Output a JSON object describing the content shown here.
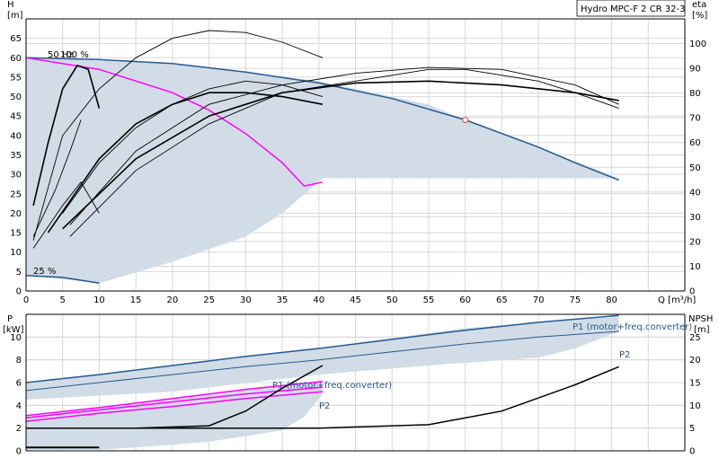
{
  "chart_data": [
    {
      "type": "line",
      "panel": "performance",
      "legend_box": "Hydro MPC-F 2 CR 32-3",
      "ylabel": "H",
      "yunit": "[m]",
      "y2label": "eta",
      "y2unit": "[%]",
      "xlabel": "Q [m³/h]",
      "xlim": [
        0,
        90
      ],
      "ylim": [
        0,
        70
      ],
      "y2lim": [
        0,
        110
      ],
      "xticks": [
        "0",
        "5",
        "10",
        "15",
        "20",
        "25",
        "30",
        "35",
        "40",
        "45",
        "50",
        "55",
        "60",
        "65",
        "70",
        "75",
        "80"
      ],
      "yticks": [
        "0",
        "5",
        "10",
        "15",
        "20",
        "25",
        "30",
        "35",
        "40",
        "45",
        "50",
        "55",
        "60",
        "65"
      ],
      "y2ticks": [
        "0",
        "10",
        "20",
        "30",
        "40",
        "50",
        "60",
        "70",
        "80",
        "90",
        "100"
      ],
      "grid": true,
      "annotations": [
        {
          "text": "50 Hz",
          "x": 3,
          "y": 61
        },
        {
          "text": "100 %",
          "x": 5.5,
          "y": 61
        },
        {
          "text": "25 %",
          "x": 1,
          "y": 5
        }
      ],
      "operating_point": {
        "x": 60,
        "y": 44,
        "color": "#e04040"
      },
      "colors": {
        "area": "#d1dce7",
        "two_pump": "#25598f",
        "one_pump": "#ff00ff",
        "efficiency": "#000000"
      },
      "series": [
        {
          "role": "area",
          "points": [
            [
              0,
              60
            ],
            [
              20,
              58.5
            ],
            [
              40,
              54
            ],
            [
              55,
              48
            ],
            [
              60,
              44
            ],
            [
              70,
              37
            ],
            [
              81,
              29
            ],
            [
              40.5,
              29
            ],
            [
              35,
              20
            ],
            [
              30,
              14
            ],
            [
              20,
              7.5
            ],
            [
              10,
              2
            ],
            [
              0,
              4
            ]
          ]
        },
        {
          "role": "two_pump",
          "points": [
            [
              0,
              60
            ],
            [
              10,
              59.5
            ],
            [
              20,
              58.5
            ],
            [
              30,
              56.3
            ],
            [
              40,
              53.5
            ],
            [
              50,
              49.5
            ],
            [
              60,
              44
            ],
            [
              70,
              37
            ],
            [
              75,
              33
            ],
            [
              81,
              28.5
            ]
          ]
        },
        {
          "role": "one_pump",
          "points": [
            [
              0,
              60
            ],
            [
              10,
              57
            ],
            [
              20,
              51
            ],
            [
              25,
              46.5
            ],
            [
              30,
              40.5
            ],
            [
              35,
              33
            ],
            [
              38,
              27
            ],
            [
              40.5,
              28
            ]
          ]
        },
        {
          "role": "min_curve",
          "points": [
            [
              0,
              4
            ],
            [
              5,
              3.5
            ],
            [
              10,
              2
            ]
          ]
        },
        {
          "role": "efficiency",
          "points": [
            [
              1,
              13
            ],
            [
              5,
              40
            ],
            [
              10,
              52
            ],
            [
              15,
              60
            ],
            [
              20,
              65
            ],
            [
              25,
              67
            ],
            [
              30,
              66.5
            ],
            [
              35,
              64
            ],
            [
              40.5,
              60
            ]
          ]
        },
        {
          "role": "efficiency",
          "points": [
            [
              5,
              20
            ],
            [
              10,
              33
            ],
            [
              15,
              42
            ],
            [
              20,
              48
            ],
            [
              25,
              52
            ],
            [
              30,
              54
            ],
            [
              35,
              53
            ],
            [
              40.5,
              50
            ]
          ]
        },
        {
          "role": "efficiency",
          "points": [
            [
              3,
              15
            ],
            [
              10,
              34
            ],
            [
              15,
              43
            ],
            [
              20,
              48
            ],
            [
              25,
              51
            ],
            [
              30,
              51
            ],
            [
              35,
              50
            ],
            [
              40.5,
              48
            ]
          ]
        },
        {
          "role": "efficiency",
          "points": [
            [
              1,
              11
            ],
            [
              5,
              22
            ],
            [
              7.5,
              28
            ],
            [
              10,
              20
            ]
          ]
        },
        {
          "role": "efficiency",
          "points": [
            [
              1,
              14
            ],
            [
              4,
              26
            ],
            [
              6,
              36
            ],
            [
              7.5,
              44
            ]
          ]
        },
        {
          "role": "efficiency",
          "points": [
            [
              1,
              22
            ],
            [
              3,
              38
            ],
            [
              5,
              52
            ],
            [
              7,
              58
            ],
            [
              8.5,
              57
            ],
            [
              10,
              47
            ]
          ]
        },
        {
          "role": "efficiency",
          "points": [
            [
              6,
              14
            ],
            [
              15,
              31
            ],
            [
              25,
              43
            ],
            [
              35,
              51
            ],
            [
              45,
              54
            ],
            [
              55,
              57
            ],
            [
              60,
              57
            ],
            [
              70,
              54
            ],
            [
              75,
              51
            ],
            [
              81,
              47
            ]
          ]
        },
        {
          "role": "efficiency",
          "points": [
            [
              6,
              17
            ],
            [
              15,
              36
            ],
            [
              25,
              48
            ],
            [
              35,
              53
            ],
            [
              45,
              56
            ],
            [
              55,
              57.5
            ],
            [
              65,
              57
            ],
            [
              75,
              53
            ],
            [
              81,
              48
            ]
          ]
        },
        {
          "role": "efficiency",
          "points": [
            [
              5,
              16
            ],
            [
              15,
              34
            ],
            [
              25,
              45
            ],
            [
              35,
              51
            ],
            [
              45,
              53.5
            ],
            [
              55,
              54
            ],
            [
              65,
              53
            ],
            [
              75,
              51
            ],
            [
              81,
              49
            ]
          ]
        }
      ]
    },
    {
      "type": "line",
      "panel": "power_npsh",
      "ylabel": "P",
      "yunit": "[kW]",
      "y2label": "NPSH",
      "y2unit": "[m]",
      "xlim": [
        0,
        90
      ],
      "ylim": [
        0,
        12
      ],
      "y2lim": [
        0,
        30
      ],
      "yticks": [
        "0",
        "2",
        "4",
        "6",
        "8",
        "10"
      ],
      "y2ticks": [
        "0",
        "5",
        "10",
        "15",
        "20",
        "25"
      ],
      "grid": true,
      "labels": [
        {
          "text": "P1 (motor+freq.converter)",
          "x": 62,
          "y": 12.1,
          "color": "#25598f"
        },
        {
          "text": "P2",
          "x": 80,
          "y": 9.8,
          "color": "#25598f"
        },
        {
          "text": "P1 (motor+freq.converter)",
          "x": 33,
          "y": 6.6,
          "color": "#25598f"
        },
        {
          "text": "P2",
          "x": 39,
          "y": 4.4,
          "color": "#25598f"
        }
      ],
      "series": [
        {
          "role": "area",
          "points": [
            [
              0,
              6
            ],
            [
              20,
              7.5
            ],
            [
              40,
              9
            ],
            [
              60,
              10.8
            ],
            [
              81,
              11.8
            ],
            [
              81,
              10.5
            ],
            [
              75,
              9
            ],
            [
              70,
              8.2
            ],
            [
              55,
              7.5
            ],
            [
              40,
              6.7
            ],
            [
              20,
              5.2
            ],
            [
              0,
              4.5
            ]
          ]
        },
        {
          "role": "area",
          "points": [
            [
              0,
              3
            ],
            [
              10,
              3.8
            ],
            [
              20,
              4.6
            ],
            [
              30,
              5.4
            ],
            [
              40.5,
              6
            ],
            [
              40.5,
              5
            ],
            [
              38,
              3
            ],
            [
              35,
              1.8
            ],
            [
              25,
              0.8
            ],
            [
              15,
              0.3
            ],
            [
              10,
              0.1
            ],
            [
              0,
              0.1
            ]
          ]
        },
        {
          "role": "P1_two_pump",
          "points": [
            [
              0,
              6
            ],
            [
              10,
              6.7
            ],
            [
              20,
              7.5
            ],
            [
              30,
              8.3
            ],
            [
              40,
              9
            ],
            [
              50,
              9.8
            ],
            [
              60,
              10.6
            ],
            [
              70,
              11.3
            ],
            [
              81,
              11.9
            ]
          ]
        },
        {
          "role": "P2_two_pump",
          "points": [
            [
              0,
              5.3
            ],
            [
              10,
              6
            ],
            [
              20,
              6.7
            ],
            [
              30,
              7.4
            ],
            [
              40,
              8
            ],
            [
              50,
              8.7
            ],
            [
              60,
              9.4
            ],
            [
              70,
              10
            ],
            [
              81,
              10.5
            ]
          ]
        },
        {
          "role": "P1_one_pump",
          "points": [
            [
              0,
              3.1
            ],
            [
              10,
              3.8
            ],
            [
              20,
              4.6
            ],
            [
              30,
              5.4
            ],
            [
              40.5,
              6.1
            ]
          ]
        },
        {
          "role": "P1_one_pump",
          "points": [
            [
              0,
              2.9
            ],
            [
              10,
              3.6
            ],
            [
              20,
              4.3
            ],
            [
              30,
              5
            ],
            [
              40.5,
              5.6
            ]
          ]
        },
        {
          "role": "P2_one_pump",
          "points": [
            [
              0,
              2.6
            ],
            [
              10,
              3.3
            ],
            [
              20,
              3.9
            ],
            [
              30,
              4.6
            ],
            [
              40.5,
              5.2
            ]
          ]
        },
        {
          "role": "NPSH",
          "points": [
            [
              0,
              2
            ],
            [
              15,
              2
            ],
            [
              25,
              2.2
            ],
            [
              30,
              3.5
            ],
            [
              35,
              5.5
            ],
            [
              40.5,
              7.5
            ]
          ]
        },
        {
          "role": "NPSH",
          "points": [
            [
              0,
              2
            ],
            [
              40,
              2
            ],
            [
              55,
              2.3
            ],
            [
              65,
              3.5
            ],
            [
              75,
              5.8
            ],
            [
              81,
              7.4
            ]
          ]
        },
        {
          "role": "NPSH_low",
          "points": [
            [
              0,
              0.3
            ],
            [
              10,
              0.3
            ]
          ]
        }
      ]
    }
  ]
}
